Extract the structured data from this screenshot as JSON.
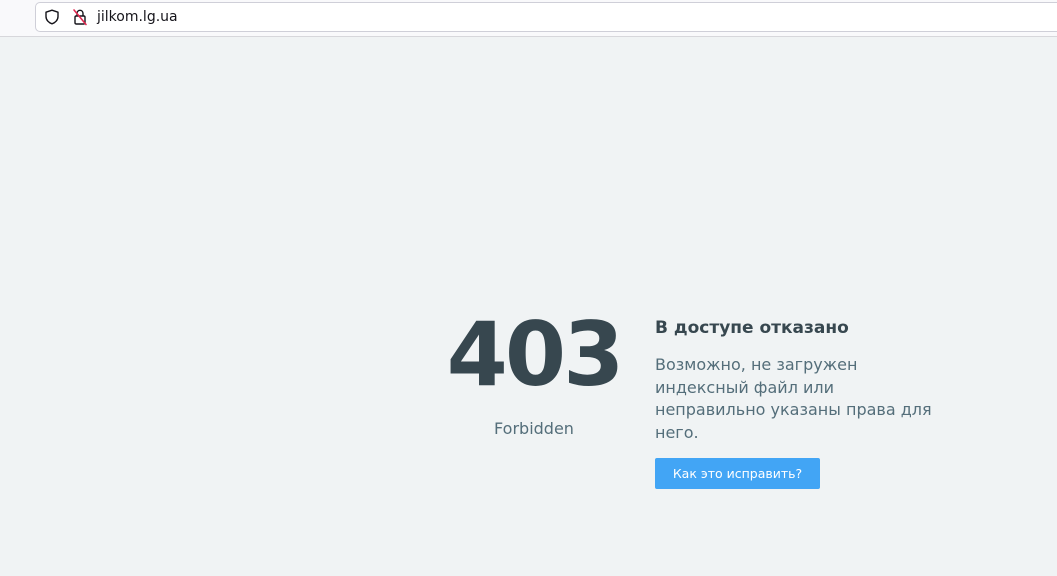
{
  "browser": {
    "url": "jilkom.lg.ua",
    "icons": [
      "shield-icon",
      "insecure-lock-icon"
    ]
  },
  "error": {
    "code": "403",
    "status": "Forbidden",
    "title": "В доступе отказано",
    "description": "Возможно, не загружен индексный файл или неправильно указаны права для него.",
    "button_label": "Как это исправить?"
  },
  "colors": {
    "background": "#f0f3f4",
    "code_text": "#37474f",
    "body_text": "#546e7a",
    "button_bg": "#42a5f5",
    "lock_warning": "#e22850"
  }
}
